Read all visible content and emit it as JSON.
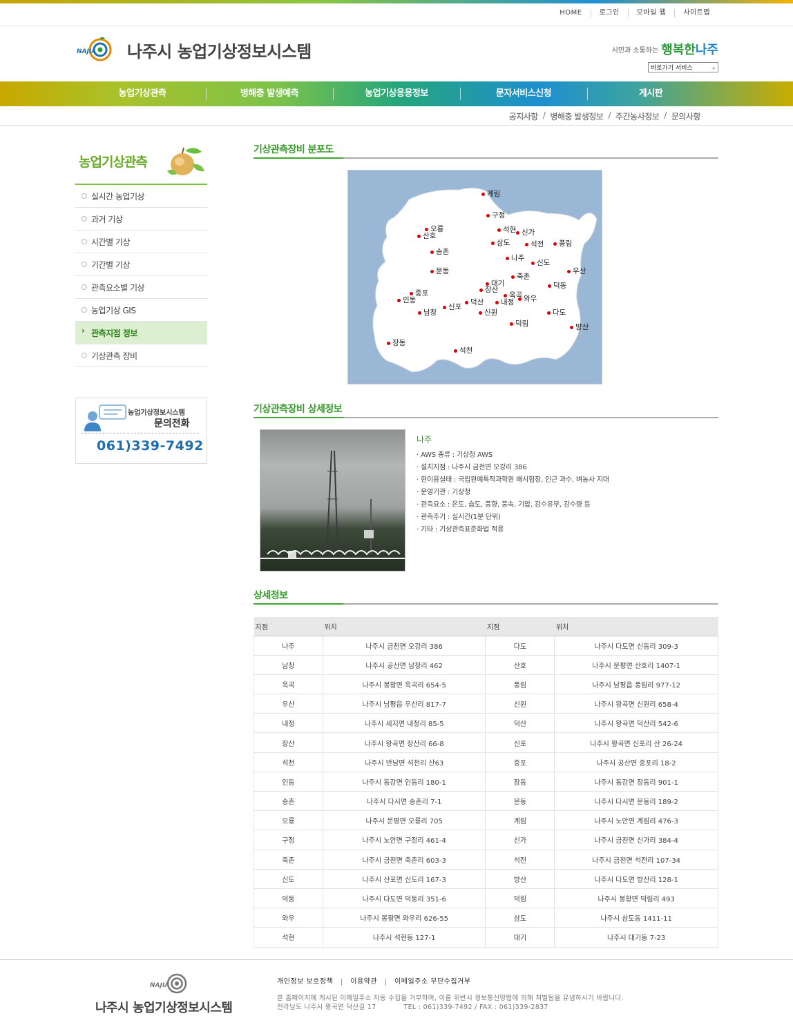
{
  "util_nav": [
    "HOME",
    "로그인",
    "모바일 웹",
    "사이트맵"
  ],
  "site": {
    "title": "나주시 농업기상정보시스템",
    "logo_text": "NAJU"
  },
  "slogan": {
    "small": "시민과 소통하는",
    "big": "행복한",
    "big2": "나주"
  },
  "quick_select": "바로가기 서비스",
  "gnb": [
    "농업기상관측",
    "병해충 발생예측",
    "농업기상응용정보",
    "문자서비스신청",
    "게시판"
  ],
  "sub_nav": [
    "공지사항",
    "병해충 발생정보",
    "주간농사정보",
    "문의사항"
  ],
  "lnb": {
    "title": "농업기상관측",
    "items": [
      "실시간 농업기상",
      "과거 기상",
      "시간별 기상",
      "기간별 기상",
      "관측요소별 기상",
      "농업기상 GIS",
      "관측지점 정보",
      "기상관측 장비"
    ],
    "active_index": 6
  },
  "contact": {
    "line1": "농업기상정보시스템",
    "line2": "문의전화",
    "phone": "061)339-7492"
  },
  "sections": {
    "map": "기상관측장비 분포도",
    "equip": "기상관측장비 상세정보",
    "detail": "상세정보"
  },
  "map_stations": [
    "계림",
    "구정",
    "오룡",
    "산호",
    "석현",
    "신가",
    "삼도",
    "석전",
    "풍림",
    "송촌",
    "나주",
    "신도",
    "우산",
    "문동",
    "죽촌",
    "대기",
    "덕동",
    "장산",
    "중포",
    "인동",
    "옥곡",
    "와우",
    "덕산",
    "신포",
    "내정",
    "남창",
    "신원",
    "다도",
    "덕림",
    "방산",
    "장동",
    "석천"
  ],
  "equipment": {
    "name": "나주",
    "rows": [
      "· AWS 종류 : 기상청 AWS",
      "· 설치지점 : 나주시 금천면 오강리 386",
      "· 현이용실태 : 국립원예특작과학원 배시험장, 인근 과수, 벼농사 지대",
      "· 운영기관 : 기상청",
      "· 관측요소 : 온도, 습도, 풍향, 풍속, 기압, 강수유무, 강수량 등",
      "· 관측주기 : 실시간(1분 단위)",
      "· 기타 : 기상관측표준화법 적용"
    ]
  },
  "table": {
    "headers": [
      "지점",
      "위치",
      "지점",
      "위치"
    ],
    "rows": [
      [
        "나주",
        "나주시 금천면 오강리 386",
        "다도",
        "나주시 다도면 신동리 309-3"
      ],
      [
        "남창",
        "나주시 공산면 남창리 462",
        "산호",
        "나주시 문평면 산호리 1407-1"
      ],
      [
        "옥곡",
        "나주시 봉황면 옥곡리 654-5",
        "풍림",
        "나주시 남평읍 풍림리 977-12"
      ],
      [
        "우산",
        "나주시 남평읍 우산리 817-7",
        "신원",
        "나주시 왕곡면 신원리 658-4"
      ],
      [
        "내정",
        "나주시 세지면 내정리 85-5",
        "덕산",
        "나주시 왕곡면 덕산리 542-6"
      ],
      [
        "장산",
        "나주시 왕곡면 장산리 66-8",
        "신포",
        "나주시 왕곡면 신포리 산 26-24"
      ],
      [
        "석천",
        "나주시 반남면 석천리 산63",
        "중포",
        "나주시 공산면 중포리 18-2"
      ],
      [
        "인동",
        "나주시 동강면 인동리 180-1",
        "장동",
        "나주시 동강면 장동리 901-1"
      ],
      [
        "송촌",
        "나주시 다시면 송촌리 7-1",
        "문동",
        "나주시 다시면 문동리 189-2"
      ],
      [
        "오룡",
        "나주시 문평면 오룡리 705",
        "계림",
        "나주시 노안면 계림리 476-3"
      ],
      [
        "구정",
        "나주시 노안면 구정리 461-4",
        "신가",
        "나주시 금천면 신가리 384-4"
      ],
      [
        "죽촌",
        "나주시 금천면 죽촌리 603-3",
        "석전",
        "나주시 금천면 석전리 107-34"
      ],
      [
        "신도",
        "나주시 산포면 신도리 167-3",
        "방산",
        "나주시 다도면 방산리 128-1"
      ],
      [
        "덕동",
        "나주시 다도면 덕동리 351-6",
        "덕림",
        "나주시 봉황면 덕림리 493"
      ],
      [
        "와우",
        "나주시 봉황면 와우리 626-55",
        "삼도",
        "나주시 삼도동 1411-11"
      ],
      [
        "석현",
        "나주시 석현동 127-1",
        "대기",
        "나주시 대기동 7-23"
      ]
    ]
  },
  "footer": {
    "links": [
      "개인정보 보호정책",
      "이용약관",
      "이메일주소 무단수집거부"
    ],
    "notice": "본 홈페이지에 게시된 이메일주소 자동 수집을 거부하며, 이를 위반시 정보통신망법에 의해 처벌됨을 유념하시기 바랍니다.",
    "address": "전라남도 나주시 왕곡면 덕산길 17",
    "tel": "TEL : 061)339-7492 / FAX : 061)339-2837"
  },
  "colors": {
    "brand_green": "#3a9a2e",
    "brand_blue": "#1e86c8",
    "marker": "#e00000",
    "sea": "#9ab7d5"
  }
}
